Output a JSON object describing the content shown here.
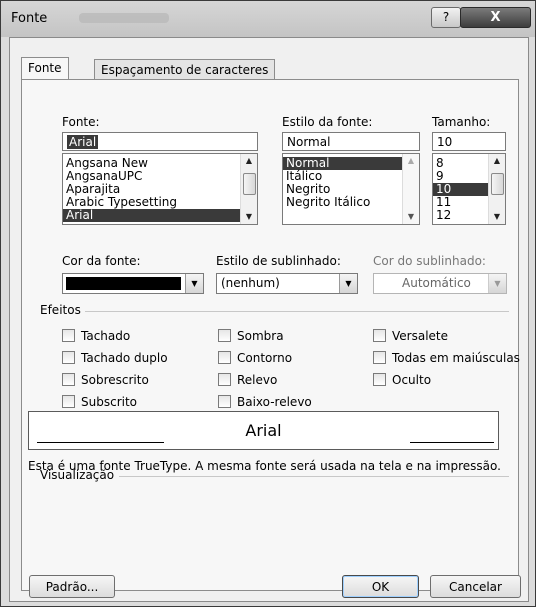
{
  "window": {
    "title": "Fonte",
    "help_label": "?",
    "close_label": "X"
  },
  "tabs": [
    {
      "label": "Fonte",
      "active": true
    },
    {
      "label": "Espaçamento de caracteres",
      "active": false
    }
  ],
  "font": {
    "label": "Fonte:",
    "value": "Arial",
    "list": [
      "Angsana New",
      "AngsanaUPC",
      "Aparajita",
      "Arabic Typesetting",
      "Arial"
    ],
    "selected": "Arial"
  },
  "style": {
    "label": "Estilo da fonte:",
    "value": "Normal",
    "list": [
      "Normal",
      "Itálico",
      "Negrito",
      "Negrito Itálico"
    ],
    "selected": "Normal"
  },
  "size": {
    "label": "Tamanho:",
    "value": "10",
    "list": [
      "8",
      "9",
      "10",
      "11",
      "12"
    ],
    "selected": "10"
  },
  "font_color": {
    "label": "Cor da fonte:",
    "value_color": "#000000"
  },
  "underline_style": {
    "label": "Estilo de sublinhado:",
    "value": "(nenhum)"
  },
  "underline_color": {
    "label": "Cor do sublinhado:",
    "value": "Automático"
  },
  "effects": {
    "label": "Efeitos",
    "items": [
      {
        "label": "Tachado",
        "checked": false
      },
      {
        "label": "Tachado duplo",
        "checked": false
      },
      {
        "label": "Sobrescrito",
        "checked": false
      },
      {
        "label": "Subscrito",
        "checked": false
      },
      {
        "label": "Sombra",
        "checked": false
      },
      {
        "label": "Contorno",
        "checked": false
      },
      {
        "label": "Relevo",
        "checked": false
      },
      {
        "label": "Baixo-relevo",
        "checked": false
      },
      {
        "label": "Versalete",
        "checked": false
      },
      {
        "label": "Todas em maiúsculas",
        "checked": false
      },
      {
        "label": "Oculto",
        "checked": false
      }
    ]
  },
  "preview": {
    "label": "Visualização",
    "sample": "Arial",
    "info": "Esta é uma fonte TrueType. A mesma fonte será usada na tela e na impressão."
  },
  "buttons": {
    "default": "Padrão...",
    "ok": "OK",
    "cancel": "Cancelar"
  }
}
